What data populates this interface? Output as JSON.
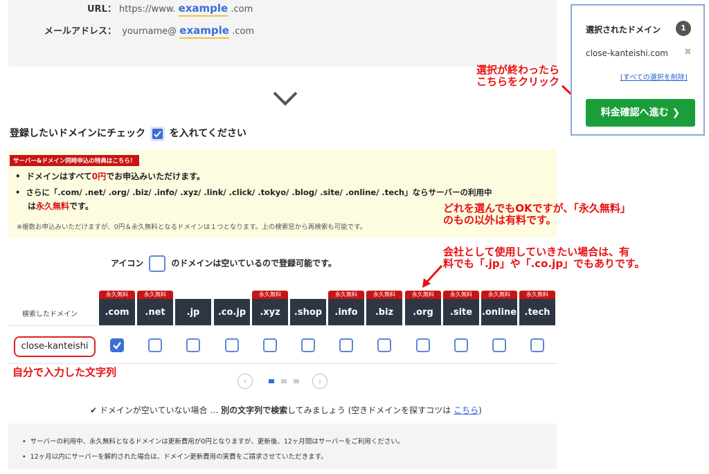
{
  "example": {
    "url_label": "URL：",
    "url_prefix": "https://www.",
    "url_strong": "example",
    "url_suffix": ".com",
    "mail_label": "メールアドレス：",
    "mail_prefix": "yourname@",
    "mail_strong": "example",
    "mail_suffix": ".com"
  },
  "heading": {
    "before": "登録したいドメインにチェック",
    "after": "を入れてください"
  },
  "notice": {
    "tag": "サーバー&ドメイン同時申込の特典はこちら！",
    "b1_pre": "ドメインはすべて",
    "b1_red": "0円",
    "b1_post": "でお申込みいただけます。",
    "b2_line1": "さらに「.com/ .net/ .org/ .biz/ .info/ .xyz/ .link/ .click/ .tokyo/ .blog/ .site/ .online/ .tech」ならサーバーの利用中",
    "b2_pre": "は",
    "b2_red": "永久無料",
    "b2_post": "です。",
    "note": "※複数お申込みいただけますが、0円＆永久無料となるドメインは１つとなります。上の検索窓から再検索も可能です。"
  },
  "icon_legend": {
    "before": "アイコン",
    "after": "のドメインは空いているので登録可能です。"
  },
  "table": {
    "row_label": "検索したドメイン",
    "badge_text": "永久無料",
    "search_word": "close-kanteishi",
    "columns": [
      {
        "tld": ".com",
        "free": true,
        "checked": true
      },
      {
        "tld": ".net",
        "free": true,
        "checked": false
      },
      {
        "tld": ".jp",
        "free": false,
        "checked": false
      },
      {
        "tld": ".co.jp",
        "free": false,
        "checked": false
      },
      {
        "tld": ".xyz",
        "free": true,
        "checked": false
      },
      {
        "tld": ".shop",
        "free": false,
        "checked": false
      },
      {
        "tld": ".info",
        "free": true,
        "checked": false
      },
      {
        "tld": ".biz",
        "free": true,
        "checked": false
      },
      {
        "tld": ".org",
        "free": true,
        "checked": false
      },
      {
        "tld": ".site",
        "free": true,
        "checked": false
      },
      {
        "tld": ".online",
        "free": true,
        "checked": false
      },
      {
        "tld": ".tech",
        "free": true,
        "checked": false
      }
    ]
  },
  "annotations": {
    "click_here": [
      "選択が終わったら",
      "こちらをクリック"
    ],
    "free_note": [
      "どれを選んでもOKですが、「永久無料」",
      "のもの以外は有料です。"
    ],
    "company_note": [
      "会社として使用していきたい場合は、有",
      "料でも「.jp」や「.co.jp」でもありです。"
    ],
    "typed_word": "自分で入力した文字列"
  },
  "pager": {
    "prev": "‹",
    "next": "›",
    "pages": 3,
    "active": 0
  },
  "tip": {
    "text_pre": "✔ ドメインが空いていない場合 … ",
    "text_strong": "別の文字列で検索",
    "text_mid": "してみましょう (空きドメインを探すコツは ",
    "link": "こちら",
    "text_post": ")"
  },
  "footer": {
    "items": [
      "サーバーの利用中、永久無料となるドメインは更新費用が0円となりますが、更新後、12ヶ月間はサーバーをご利用ください。",
      "12ヶ月以内にサーバーを解約された場合は、ドメイン更新費用の実費をご請求させていただきます。"
    ]
  },
  "panel": {
    "title": "選択されたドメイン",
    "count": "1",
    "selected": "close-kanteishi.com",
    "remove": "✖",
    "clear_all": "[すべての選択を削除]",
    "proceed": "料金確認へ進む ❯"
  },
  "colors": {
    "accent": "#3b6fd6",
    "header_bg": "#2e3644",
    "badge": "#c81414",
    "proceed": "#1a9e3a",
    "annotation": "#e81010"
  }
}
